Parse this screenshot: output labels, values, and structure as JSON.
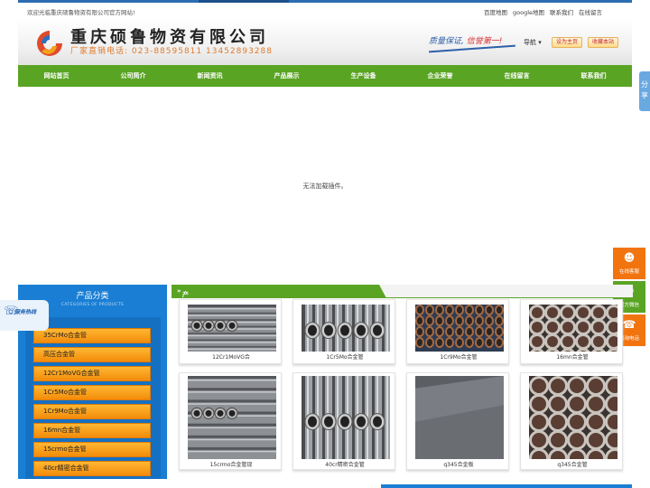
{
  "topbar": {
    "welcome": "欢迎光临重庆硕鲁物资有限公司官方网站!",
    "links": [
      "百度地图",
      "google地图",
      "联系我们",
      "在线留言"
    ]
  },
  "header": {
    "company": "重庆硕鲁物资有限公司",
    "hotline": "厂家直销电话: 023-88595811 13452893288",
    "slogan_a": "质量保证,",
    "slogan_b": "信誉第一!",
    "nav_dropdown": "导航",
    "homepage_button": "设为主页",
    "favorite_button": "收藏本站"
  },
  "nav": [
    "网站首页",
    "公司简介",
    "新闻资讯",
    "产品展示",
    "生产设备",
    "企业荣誉",
    "在线留言",
    "联系我们"
  ],
  "plugin_message": "无法加载插件。",
  "share_tab": "分享",
  "float_service": {
    "qq": "在线客服",
    "wechat": "官方微信",
    "phone": "咨询电话"
  },
  "sidebar": {
    "title": "产品分类",
    "subtitle": "CATEGORIES OF PRODUCTS",
    "badge": "服务热线",
    "items": [
      "35CrMo合金管",
      "高压合金管",
      "12Cr1MoVG合金管",
      "1Cr5Mo合金管",
      "1Cr9Mo合金管",
      "16mn合金管",
      "15crmo合金管",
      "40cr精密合金管"
    ]
  },
  "products": {
    "heading": "产品展示",
    "items": [
      {
        "caption": "12Cr1MoVG合",
        "icon": "pipe-bundle-photo"
      },
      {
        "caption": "1Cr5Mo合金管",
        "icon": "pipe-stack-photo"
      },
      {
        "caption": "1Cr9Mo合金管",
        "icon": "pipe-rows-photo"
      },
      {
        "caption": "16mn合金管",
        "icon": "pipe-ends-photo"
      },
      {
        "caption": "15crmo合金管现",
        "icon": "pipe-bundle-photo"
      },
      {
        "caption": "40cr精密合金管",
        "icon": "pipe-stack-photo"
      },
      {
        "caption": "q345合金板",
        "icon": "steel-plate-photo"
      },
      {
        "caption": "q345合金管",
        "icon": "pipe-ends-photo"
      }
    ]
  },
  "colors": {
    "nav_green": "#5aa424",
    "sidebar_blue": "#1a7fd4",
    "orange": "#f28c0a"
  }
}
